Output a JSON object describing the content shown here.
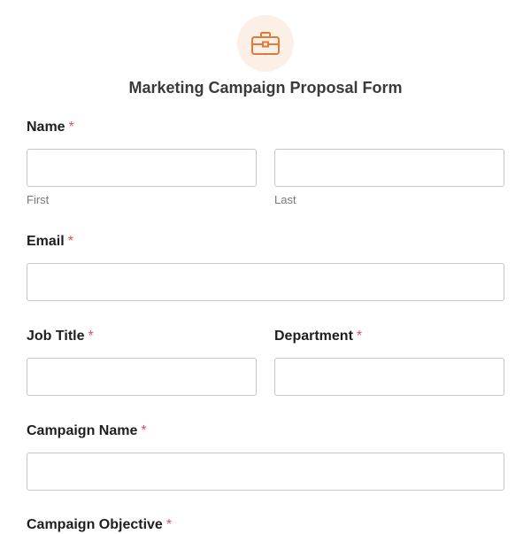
{
  "header": {
    "icon": "briefcase-icon",
    "accent_color": "#e07a3a",
    "title": "Marketing Campaign Proposal Form"
  },
  "fields": {
    "name": {
      "label": "Name",
      "required_mark": "*",
      "first_value": "",
      "last_value": "",
      "first_sublabel": "First",
      "last_sublabel": "Last"
    },
    "email": {
      "label": "Email",
      "required_mark": "*",
      "value": ""
    },
    "job_title": {
      "label": "Job Title",
      "required_mark": "*",
      "value": ""
    },
    "department": {
      "label": "Department",
      "required_mark": "*",
      "value": ""
    },
    "campaign_name": {
      "label": "Campaign Name",
      "required_mark": "*",
      "value": ""
    },
    "campaign_objective": {
      "label": "Campaign Objective",
      "required_mark": "*"
    }
  }
}
